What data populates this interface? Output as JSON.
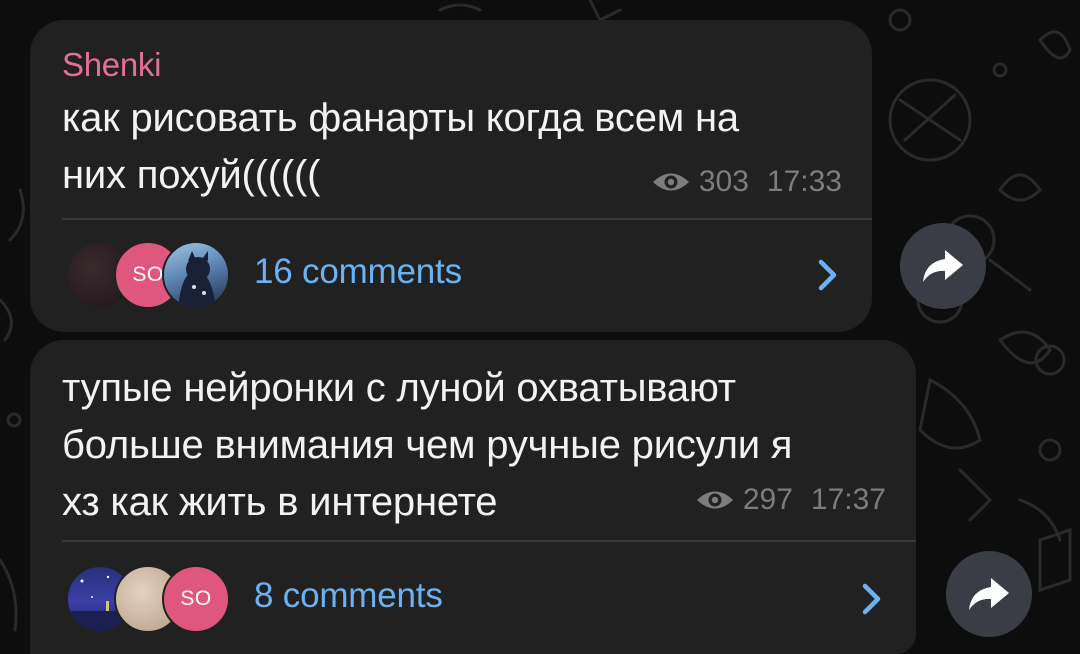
{
  "colors": {
    "background": "#0d0d0d",
    "bubble": "#212121",
    "author": "#e46e97",
    "text": "#f2f2f2",
    "meta": "#7d7d7d",
    "link": "#6cb2f2",
    "share_button": "#3a3d45",
    "avatar_so": "#e0577d"
  },
  "messages": [
    {
      "author": "Shenki",
      "text": "как рисовать фанарты когда всем на\nних похуй((((((",
      "views": "303",
      "time": "17:33",
      "comments_label": "16 comments",
      "avatars": [
        {
          "kind": "photo-dark",
          "label": ""
        },
        {
          "kind": "initials",
          "label": "SO"
        },
        {
          "kind": "photo-blue-character",
          "label": ""
        }
      ],
      "icons": {
        "views": "eye-icon",
        "open": "chevron-right-icon",
        "share": "share-arrow-icon"
      }
    },
    {
      "author": "",
      "text": "тупые нейронки с луной охватывают\nбольше внимания чем ручные рисули я\nхз как жить в интернете",
      "views": "297",
      "time": "17:37",
      "comments_label": "8 comments",
      "avatars": [
        {
          "kind": "photo-night-sky",
          "label": ""
        },
        {
          "kind": "photo-beige",
          "label": ""
        },
        {
          "kind": "initials",
          "label": "SO"
        }
      ],
      "icons": {
        "views": "eye-icon",
        "open": "chevron-right-icon",
        "share": "share-arrow-icon"
      }
    }
  ]
}
